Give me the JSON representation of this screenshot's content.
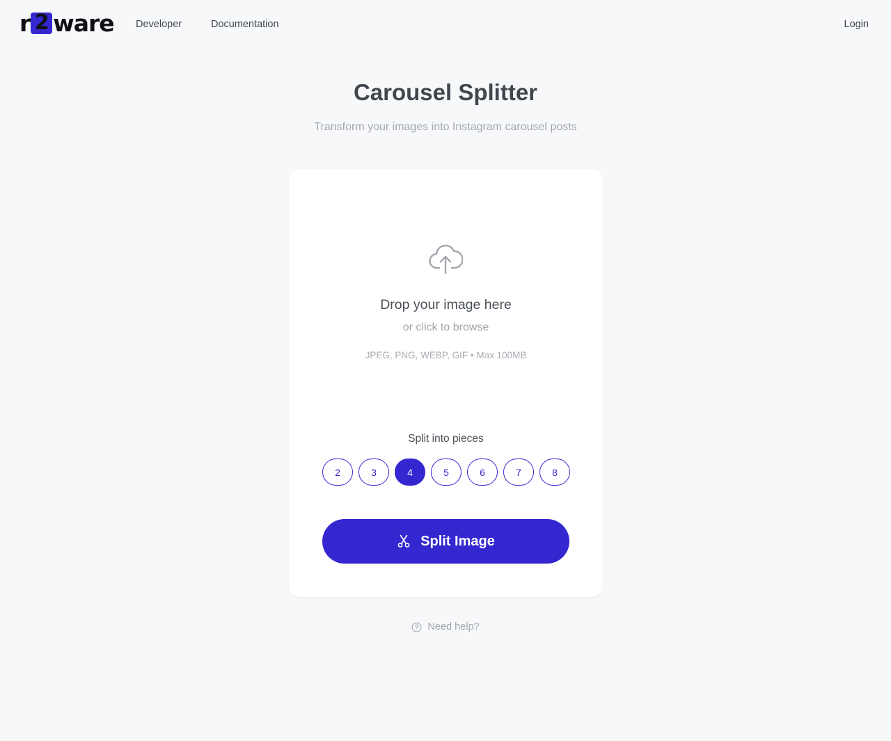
{
  "header": {
    "logo": {
      "prefix": "r",
      "box": "2",
      "suffix": "ware",
      "accent": "#3427d0"
    },
    "nav": {
      "developer": "Developer",
      "documentation": "Documentation"
    },
    "login": "Login"
  },
  "page": {
    "title": "Carousel Splitter",
    "subtitle": "Transform your images into Instagram carousel posts"
  },
  "dropzone": {
    "icon": "cloud-upload-icon",
    "title": "Drop your image here",
    "subtitle": "or click to browse",
    "formats": "JPEG, PNG, WEBP, GIF • Max 100MB"
  },
  "split": {
    "label": "Split into pieces",
    "options": [
      "2",
      "3",
      "4",
      "5",
      "6",
      "7",
      "8"
    ],
    "selected": "4",
    "button_label": "Split Image",
    "button_icon": "scissors-icon"
  },
  "help": {
    "icon": "question-circle-icon",
    "label": "Need help?"
  },
  "colors": {
    "accent": "#3427d0",
    "background": "#f7f8fa",
    "card": "#ffffff",
    "muted_text": "#a3a7ad"
  }
}
